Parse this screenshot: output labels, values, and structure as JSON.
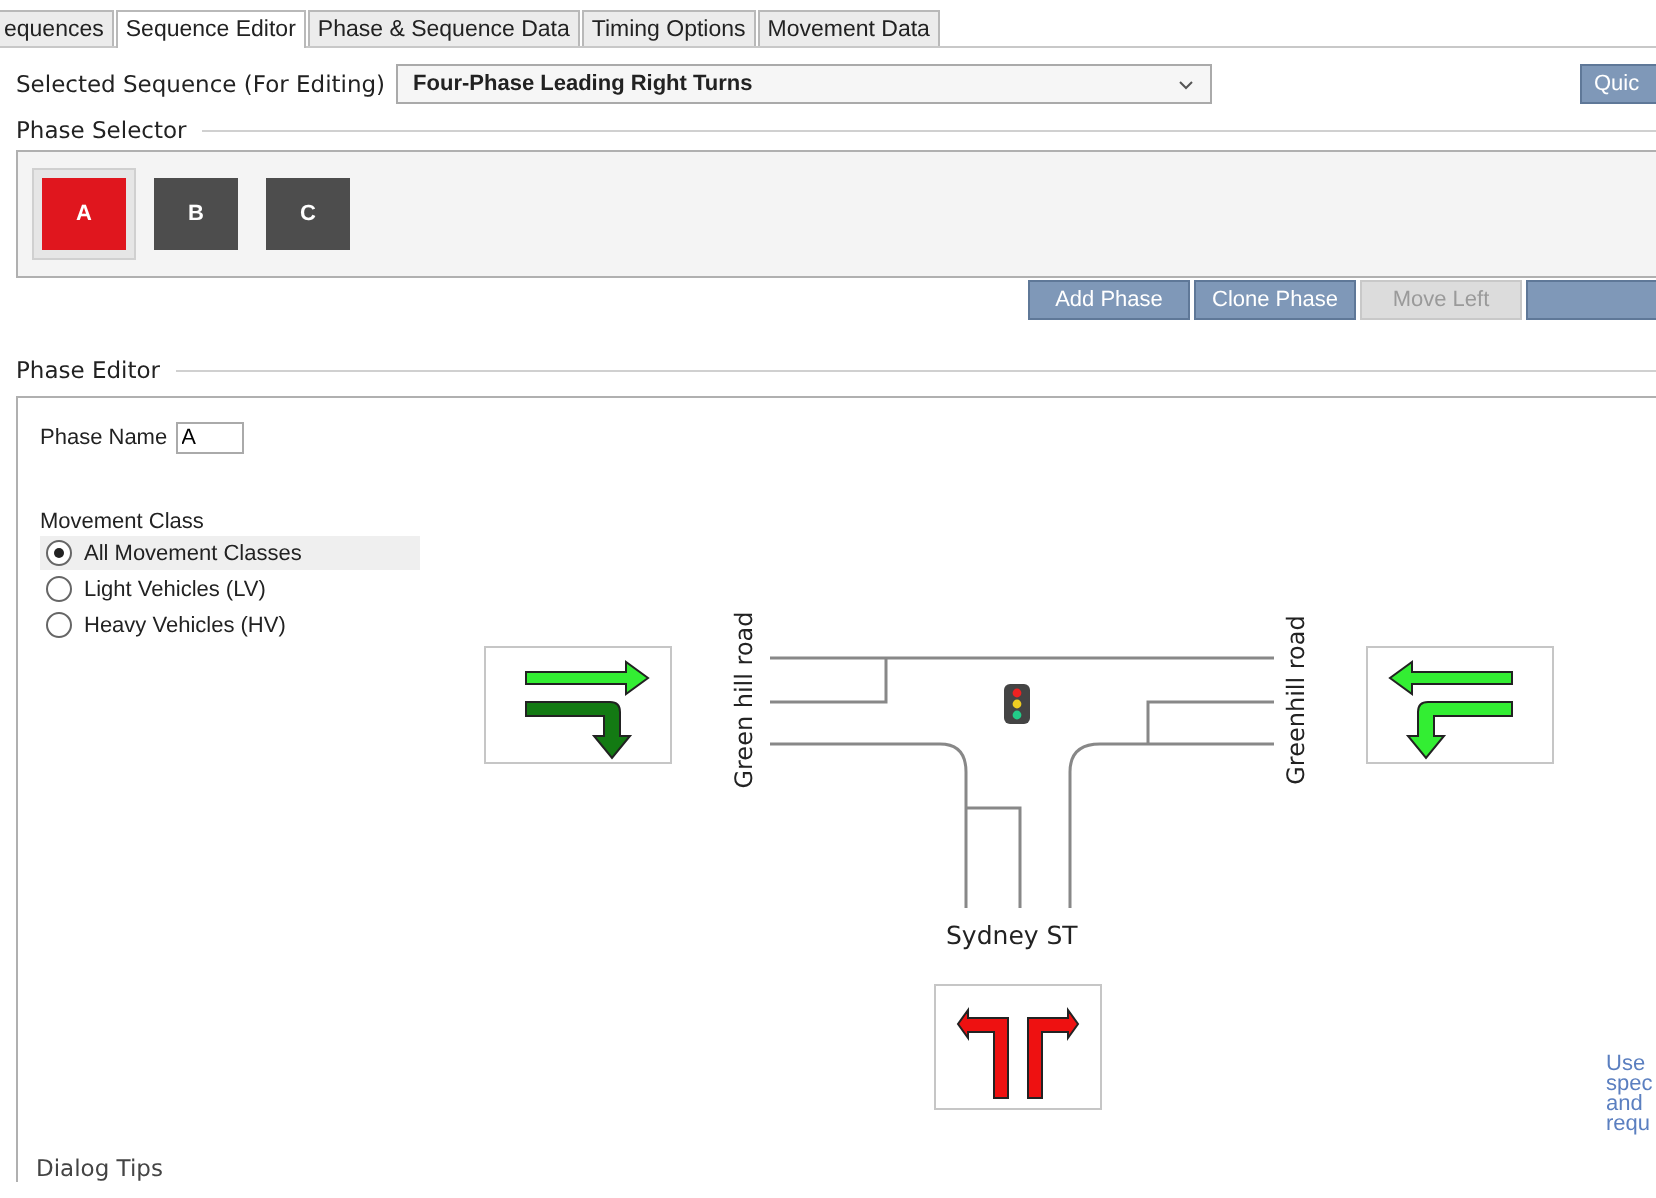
{
  "tabs": [
    {
      "label": "equences",
      "selected": false
    },
    {
      "label": "Sequence Editor",
      "selected": true
    },
    {
      "label": "Phase & Sequence Data",
      "selected": false
    },
    {
      "label": "Timing Options",
      "selected": false
    },
    {
      "label": "Movement Data",
      "selected": false
    }
  ],
  "sequence": {
    "label": "Selected Sequence (For Editing)",
    "value": "Four-Phase Leading Right Turns",
    "quick_button": "Quic"
  },
  "phase_selector": {
    "title": "Phase Selector",
    "phases": [
      {
        "label": "A",
        "selected": true
      },
      {
        "label": "B",
        "selected": false
      },
      {
        "label": "C",
        "selected": false
      }
    ]
  },
  "phase_buttons": [
    {
      "label": "Add Phase",
      "disabled": false
    },
    {
      "label": "Clone Phase",
      "disabled": false
    },
    {
      "label": "Move Left",
      "disabled": true
    }
  ],
  "phase_editor": {
    "title": "Phase Editor",
    "phase_name_label": "Phase Name",
    "phase_name": "A",
    "movement_class": {
      "title": "Movement Class",
      "options": [
        {
          "label": "All Movement Classes",
          "selected": true
        },
        {
          "label": "Light Vehicles (LV)",
          "selected": false
        },
        {
          "label": "Heavy Vehicles (HV)",
          "selected": false
        }
      ]
    },
    "roads": {
      "west": "Green hill road",
      "east": "Greenhill road",
      "south": "Sydney ST"
    },
    "approaches": [
      {
        "kind": "east",
        "movements": [
          {
            "kind": "through",
            "color": "#33ee33"
          },
          {
            "kind": "right_turn",
            "color": "#137a13"
          }
        ]
      },
      {
        "kind": "west",
        "movements": [
          {
            "kind": "through",
            "color": "#33ee33"
          },
          {
            "kind": "left_turn",
            "color": "#33ee33"
          }
        ]
      },
      {
        "kind": "north",
        "movements": [
          {
            "kind": "left_turn",
            "color": "#ee1111"
          },
          {
            "kind": "right_turn",
            "color": "#ee1111"
          }
        ]
      }
    ],
    "hint_lines": [
      "Use",
      "spec",
      "and",
      "requ"
    ]
  },
  "dialog_tips": "Dialog Tips"
}
